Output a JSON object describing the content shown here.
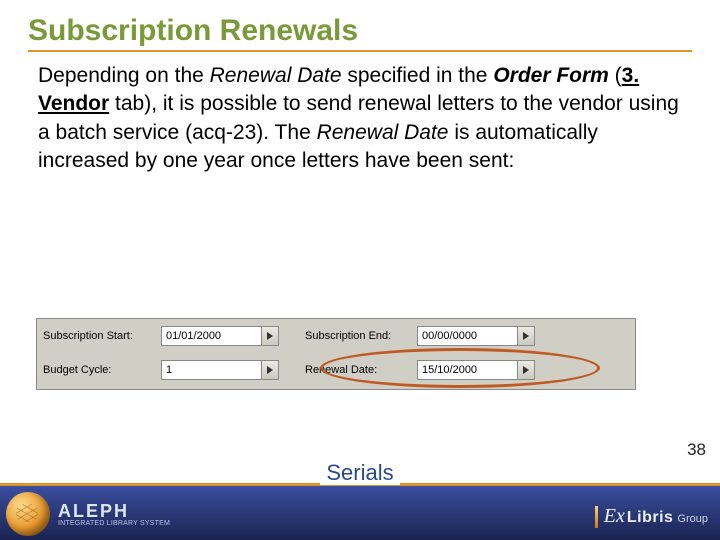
{
  "title": "Subscription Renewals",
  "paragraph": {
    "p1": "Depending on the ",
    "renewal_date_1": "Renewal Date",
    "p2": " specified in the ",
    "order_form": "Order Form",
    "p3": " (",
    "vendor_tab": "3. Vendor",
    "p4": " tab), it is possible to send renewal letters to the vendor using a batch service (acq-23). The ",
    "renewal_date_2": "Renewal Date",
    "p5": " is automatically increased by one year once letters have been sent:"
  },
  "form": {
    "sub_start_label": "Subscription Start:",
    "sub_start_value": "01/01/2000",
    "sub_end_label": "Subscription End:",
    "sub_end_value": "00/00/0000",
    "budget_label": "Budget Cycle:",
    "budget_value": "1",
    "renewal_label": "Renewal Date:",
    "renewal_value": "15/10/2000"
  },
  "page_number": "38",
  "footer": {
    "center": "Serials",
    "aleph": "ALEPH",
    "aleph_sub": "INTEGRATED LIBRARY SYSTEM",
    "ex": "Ex",
    "libris": "Libris",
    "group": "Group"
  }
}
